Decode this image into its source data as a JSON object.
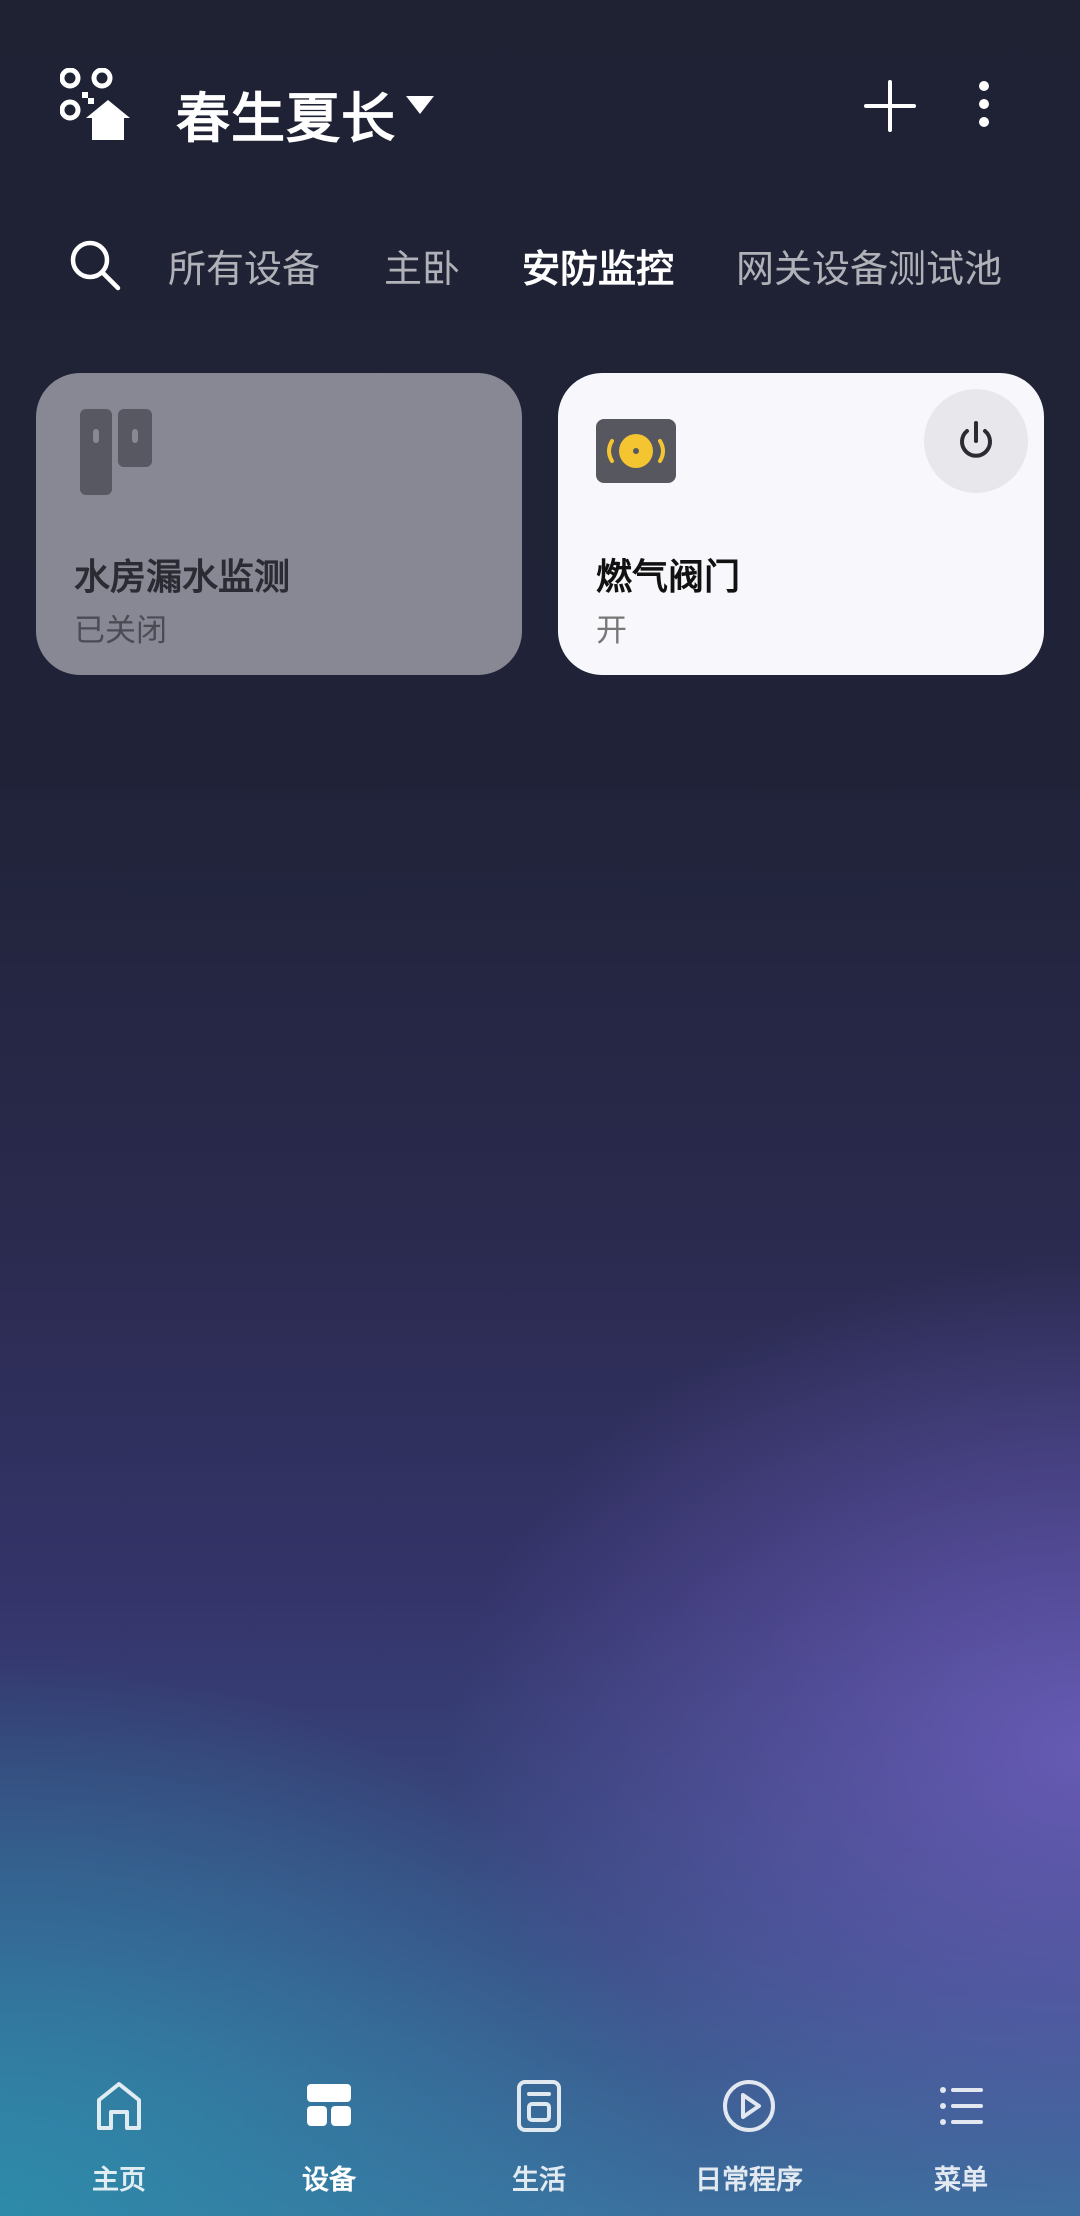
{
  "header": {
    "title": "春生夏长",
    "logo_icon": "smart-home-icon",
    "add_icon": "plus-icon",
    "more_icon": "more-vertical-icon"
  },
  "tabs": {
    "search_icon": "search-icon",
    "items": [
      {
        "label": "所有设备",
        "active": false
      },
      {
        "label": "主卧",
        "active": false
      },
      {
        "label": "安防监控",
        "active": true
      },
      {
        "label": "网关设备测试池",
        "active": false
      }
    ]
  },
  "devices": [
    {
      "name": "水房漏水监测",
      "status": "已关闭",
      "icon": "door-sensor-icon",
      "state": "off"
    },
    {
      "name": "燃气阀门",
      "status": "开",
      "icon": "gas-valve-icon",
      "state": "on",
      "power_icon": "power-icon"
    }
  ],
  "bottom_nav": [
    {
      "label": "主页",
      "icon": "home-icon",
      "active": false
    },
    {
      "label": "设备",
      "icon": "devices-icon",
      "active": true
    },
    {
      "label": "生活",
      "icon": "life-icon",
      "active": false
    },
    {
      "label": "日常程序",
      "icon": "play-circle-icon",
      "active": false
    },
    {
      "label": "菜单",
      "icon": "menu-list-icon",
      "active": false
    }
  ],
  "colors": {
    "accent_yellow": "#f4c531",
    "card_active": "#f8f8fc",
    "card_inactive": "#878893"
  }
}
